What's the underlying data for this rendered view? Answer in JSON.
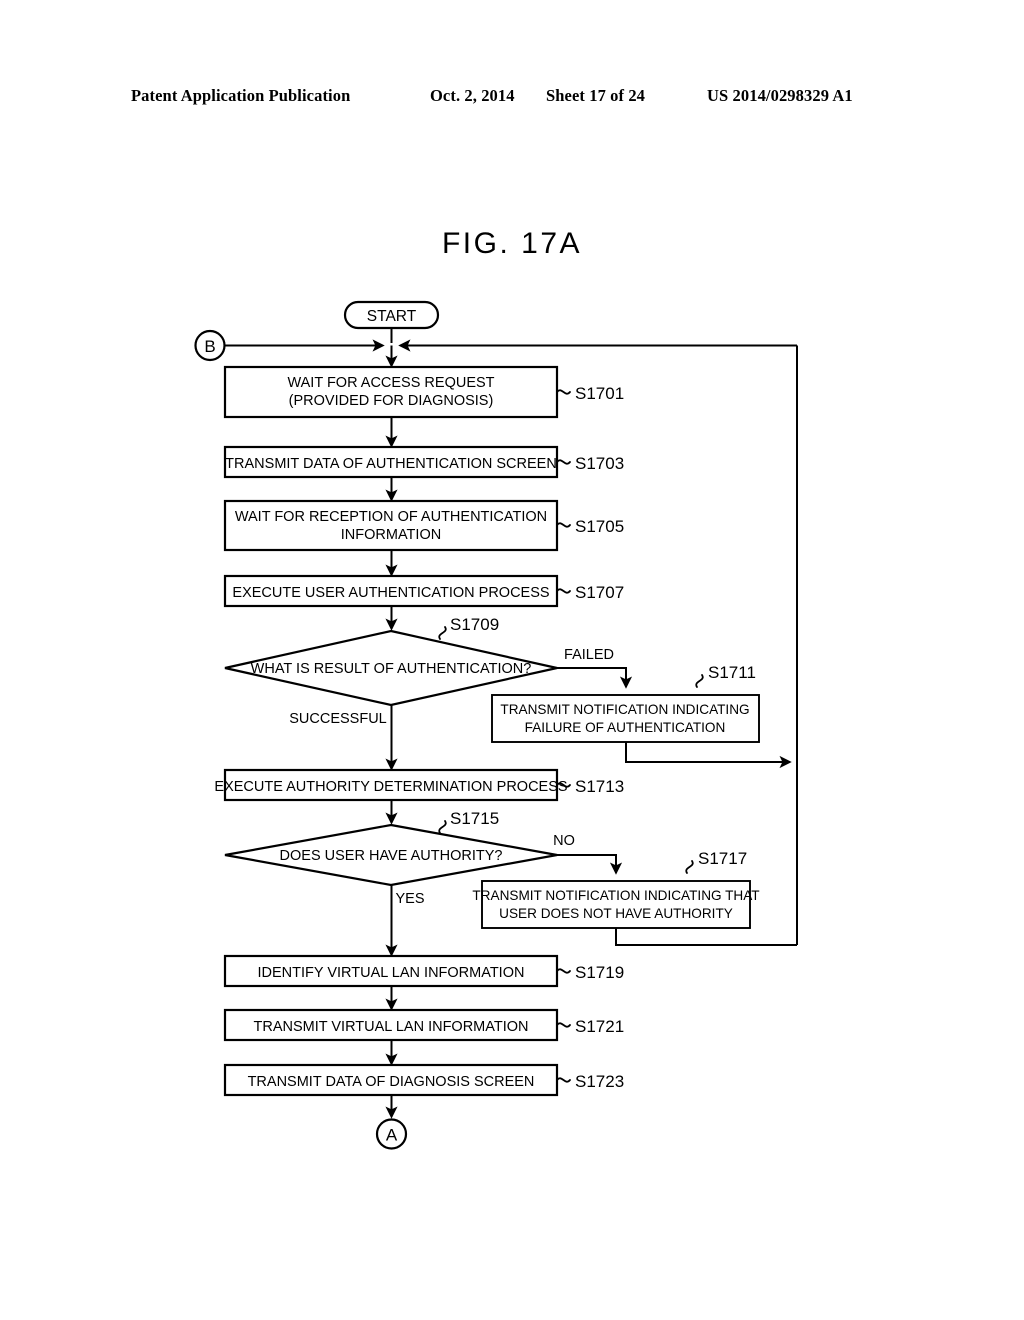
{
  "header": {
    "publication": "Patent Application Publication",
    "date": "Oct. 2, 2014",
    "sheet": "Sheet 17 of 24",
    "number": "US 2014/0298329 A1"
  },
  "figure": {
    "title": "FIG. 17A"
  },
  "flowchart": {
    "type": "flowchart",
    "terminators": {
      "start": "START"
    },
    "connectors": {
      "entry": "B",
      "exit": "A"
    },
    "steps": [
      {
        "id": "S1701",
        "label": "S1701",
        "shape": "process",
        "lines": [
          "WAIT FOR ACCESS REQUEST",
          "(PROVIDED FOR DIAGNOSIS)"
        ]
      },
      {
        "id": "S1703",
        "label": "S1703",
        "shape": "process",
        "lines": [
          "TRANSMIT DATA OF AUTHENTICATION SCREEN"
        ]
      },
      {
        "id": "S1705",
        "label": "S1705",
        "shape": "process",
        "lines": [
          "WAIT FOR RECEPTION OF AUTHENTICATION",
          "INFORMATION"
        ]
      },
      {
        "id": "S1707",
        "label": "S1707",
        "shape": "process",
        "lines": [
          "EXECUTE USER AUTHENTICATION PROCESS"
        ]
      },
      {
        "id": "S1709",
        "label": "S1709",
        "shape": "decision",
        "lines": [
          "WHAT IS RESULT OF AUTHENTICATION?"
        ]
      },
      {
        "id": "S1711",
        "label": "S1711",
        "shape": "process",
        "lines": [
          "TRANSMIT NOTIFICATION INDICATING",
          "FAILURE OF AUTHENTICATION"
        ]
      },
      {
        "id": "S1713",
        "label": "S1713",
        "shape": "process",
        "lines": [
          "EXECUTE AUTHORITY DETERMINATION PROCESS"
        ]
      },
      {
        "id": "S1715",
        "label": "S1715",
        "shape": "decision",
        "lines": [
          "DOES USER HAVE AUTHORITY?"
        ]
      },
      {
        "id": "S1717",
        "label": "S1717",
        "shape": "process",
        "lines": [
          "TRANSMIT NOTIFICATION INDICATING THAT",
          "USER DOES NOT HAVE AUTHORITY"
        ]
      },
      {
        "id": "S1719",
        "label": "S1719",
        "shape": "process",
        "lines": [
          "IDENTIFY VIRTUAL LAN INFORMATION"
        ]
      },
      {
        "id": "S1721",
        "label": "S1721",
        "shape": "process",
        "lines": [
          "TRANSMIT VIRTUAL LAN INFORMATION"
        ]
      },
      {
        "id": "S1723",
        "label": "S1723",
        "shape": "process",
        "lines": [
          "TRANSMIT DATA OF DIAGNOSIS SCREEN"
        ]
      }
    ],
    "branch_labels": {
      "s1709_failed": "FAILED",
      "s1709_successful": "SUCCESSFUL",
      "s1715_no": "NO",
      "s1715_yes": "YES"
    },
    "colors": {
      "ink": "#000000",
      "paper": "#ffffff"
    }
  }
}
